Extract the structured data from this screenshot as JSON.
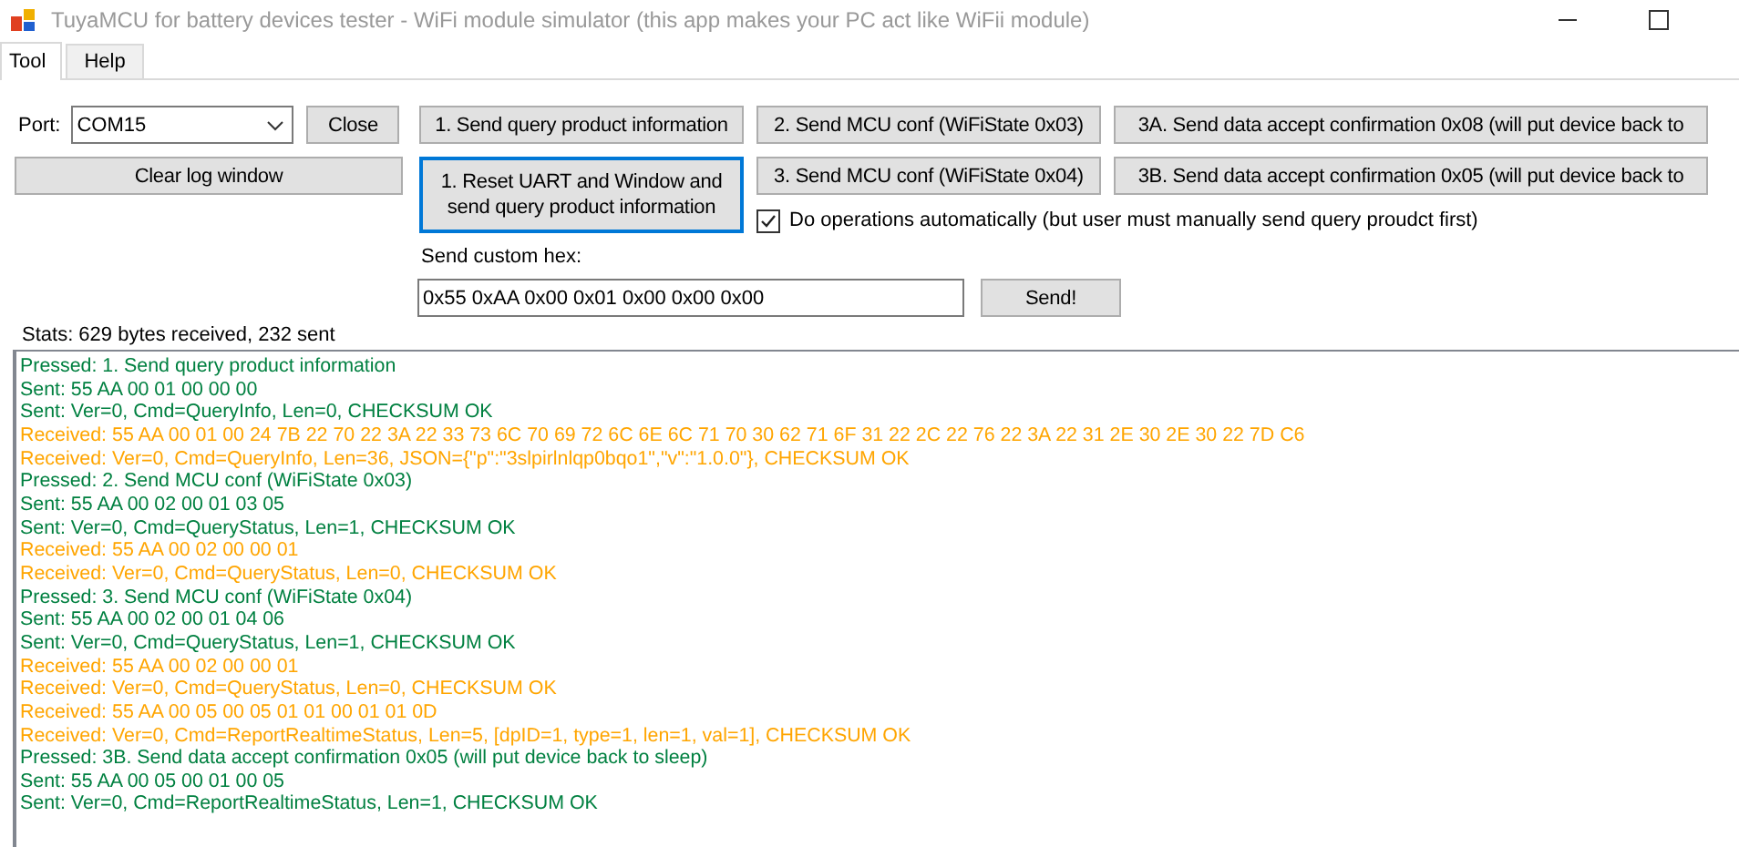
{
  "window": {
    "title": "TuyaMCU for battery devices tester - WiFi module simulator (this app makes your PC act like WiFii module)"
  },
  "tabs": [
    {
      "label": "Tool",
      "selected": true
    },
    {
      "label": "Help",
      "selected": false
    }
  ],
  "port": {
    "label": "Port:",
    "value": "COM15"
  },
  "buttons": [
    {
      "label": "Close",
      "focused": false
    },
    {
      "label": "1. Send query product information",
      "focused": false
    },
    {
      "label": "2. Send MCU conf (WiFiState 0x03)",
      "focused": false
    },
    {
      "label": "3A. Send data accept confirmation 0x08 (will put device back to",
      "focused": false
    },
    {
      "label": "Clear log window",
      "focused": false
    },
    {
      "label": "1. Reset UART and Window and send query product information",
      "focused": true
    },
    {
      "label": "3. Send MCU conf (WiFiState 0x04)",
      "focused": false
    },
    {
      "label": "3B. Send data accept confirmation 0x05 (will put device back to",
      "focused": false
    }
  ],
  "auto_checkbox": {
    "label": "Do operations automatically (but user must manually send query proudct first)",
    "checked": true
  },
  "custom_hex": {
    "label": "Send custom hex:",
    "value": "0x55 0xAA 0x00 0x01 0x00 0x00 0x00",
    "button": "Send!"
  },
  "stats": "Stats: 629 bytes received, 232 sent",
  "log": [
    {
      "text": "Pressed: 1. Send query product information",
      "color": "#008040"
    },
    {
      "text": "Sent: 55 AA 00 01 00 00 00",
      "color": "#008040"
    },
    {
      "text": "Sent: Ver=0, Cmd=QueryInfo, Len=0, CHECKSUM OK",
      "color": "#008040"
    },
    {
      "text": "Received: 55 AA 00 01 00 24 7B 22 70 22 3A 22 33 73 6C 70 69 72 6C 6E 6C 71 70 30 62 71 6F 31 22 2C 22 76 22 3A 22 31 2E 30 2E 30 22 7D C6",
      "color": "#ffa500"
    },
    {
      "text": "Received: Ver=0, Cmd=QueryInfo, Len=36, JSON={\"p\":\"3slpirlnlqp0bqo1\",\"v\":\"1.0.0\"}, CHECKSUM OK",
      "color": "#ffa500"
    },
    {
      "text": "Pressed: 2. Send MCU conf (WiFiState 0x03)",
      "color": "#008040"
    },
    {
      "text": "Sent: 55 AA 00 02 00 01 03 05",
      "color": "#008040"
    },
    {
      "text": "Sent: Ver=0, Cmd=QueryStatus, Len=1, CHECKSUM OK",
      "color": "#008040"
    },
    {
      "text": "Received: 55 AA 00 02 00 00 01",
      "color": "#ffa500"
    },
    {
      "text": "Received: Ver=0, Cmd=QueryStatus, Len=0, CHECKSUM OK",
      "color": "#ffa500"
    },
    {
      "text": "Pressed: 3. Send MCU conf (WiFiState 0x04)",
      "color": "#008040"
    },
    {
      "text": "Sent: 55 AA 00 02 00 01 04 06",
      "color": "#008040"
    },
    {
      "text": "Sent: Ver=0, Cmd=QueryStatus, Len=1, CHECKSUM OK",
      "color": "#008040"
    },
    {
      "text": "Received: 55 AA 00 02 00 00 01",
      "color": "#ffa500"
    },
    {
      "text": "Received: Ver=0, Cmd=QueryStatus, Len=0, CHECKSUM OK",
      "color": "#ffa500"
    },
    {
      "text": "Received: 55 AA 00 05 00 05 01 01 00 01 01 0D",
      "color": "#ffa500"
    },
    {
      "text": "Received: Ver=0, Cmd=ReportRealtimeStatus, Len=5, [dpID=1, type=1, len=1, val=1], CHECKSUM OK",
      "color": "#ffa500"
    },
    {
      "text": "Pressed: 3B. Send data accept confirmation 0x05 (will put device back to sleep)",
      "color": "#008040"
    },
    {
      "text": "Sent: 55 AA 00 05 00 01 00 05",
      "color": "#008040"
    },
    {
      "text": "Sent: Ver=0, Cmd=ReportRealtimeStatus, Len=1, CHECKSUM OK",
      "color": "#008040"
    }
  ]
}
